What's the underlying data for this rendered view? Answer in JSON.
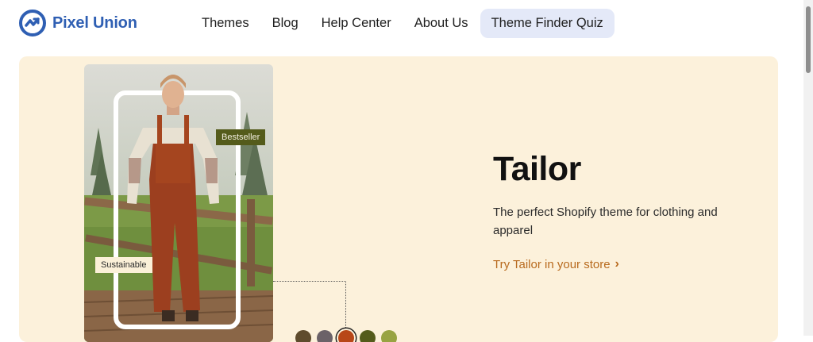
{
  "brand": {
    "name": "Pixel Union",
    "color": "#2f5fb3"
  },
  "nav": {
    "items": [
      "Themes",
      "Blog",
      "Help Center",
      "About Us",
      "Theme Finder Quiz"
    ],
    "active_index": 4
  },
  "hero": {
    "title": "Tailor",
    "description": "The perfect Shopify theme for clothing and apparel",
    "cta": "Try Tailor in your store",
    "background": "#fcf1db",
    "badges": {
      "bestseller": "Bestseller",
      "sustainable": "Sustainable"
    },
    "swatches": [
      {
        "color": "#5e4b2c",
        "selected": false
      },
      {
        "color": "#6b6268",
        "selected": false
      },
      {
        "color": "#b84718",
        "selected": true
      },
      {
        "color": "#545b1b",
        "selected": false
      },
      {
        "color": "#98a342",
        "selected": false
      }
    ]
  },
  "icons": {
    "logo": "pixel-union-logo-icon",
    "cta": "chevron-right-icon"
  }
}
